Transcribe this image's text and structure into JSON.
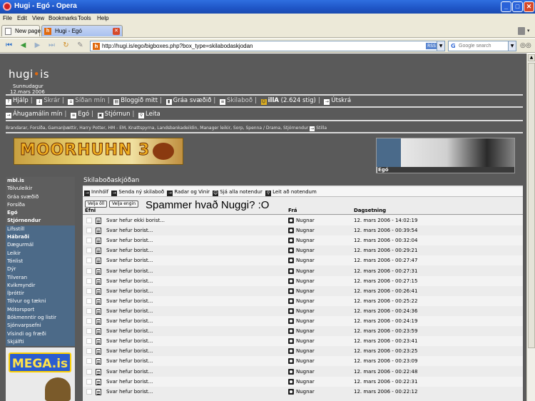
{
  "window": {
    "title": "Hugi - Egó - Opera"
  },
  "menu": [
    "File",
    "Edit",
    "View",
    "Bookmarks",
    "Tools",
    "Help"
  ],
  "tabs": [
    {
      "label": "New page"
    },
    {
      "label": "Hugi - Egó"
    }
  ],
  "address": {
    "url": "http://hugi.is/ego/bigboxes.php?box_type=skilabodaskjodan",
    "rss": "RSS"
  },
  "search": {
    "placeholder": "Google search"
  },
  "site": {
    "logo_text": "hugi",
    "logo_suffix": "is",
    "day": "Sunnudagur",
    "date": "12.mars 2006"
  },
  "topnav": {
    "row1": [
      {
        "label": "Hjálp"
      },
      {
        "label": "Skrár"
      },
      {
        "label": "Síðan mín"
      },
      {
        "label": "Bloggið mitt"
      },
      {
        "label": "Gráa svæðið"
      },
      {
        "label": "Skilaboð"
      },
      {
        "label": "illA",
        "extra": "(2.624 stig)"
      },
      {
        "label": "Útskrá"
      }
    ],
    "row2": [
      {
        "label": "Áhugamálin mín"
      },
      {
        "label": "Egó"
      },
      {
        "label": "Stjórnun"
      },
      {
        "label": "Leita"
      }
    ],
    "row3": "Brandarar, Forsíða, Gamanþættir, Harry Potter, HM - EM, Knattspyrna, Landsbankadeildin, Manager leikir, Sorp, Spenna / Drama, Stjórnendur",
    "row3_link": "Stilla"
  },
  "banners": {
    "moorhuhn": "MOORHUHN 3",
    "ego_label": "Egó",
    "mega": "MEGA.is"
  },
  "sidebar": {
    "top": [
      {
        "label": "mbl.is",
        "bold": true
      },
      {
        "label": "Tölvuleikir",
        "bold": false
      },
      {
        "label": "Gráa svæðið",
        "bold": false
      },
      {
        "label": "Forsíða",
        "bold": false
      },
      {
        "label": "Egó",
        "bold": true
      },
      {
        "label": "Stjórnendur",
        "bold": true
      }
    ],
    "bottom": [
      {
        "label": "Lífsstíll",
        "bold": false
      },
      {
        "label": "Hábraði",
        "bold": true
      },
      {
        "label": "Dægurmál",
        "bold": false
      },
      {
        "label": "Leikir",
        "bold": false
      },
      {
        "label": "Tónlist",
        "bold": false
      },
      {
        "label": "Dýr",
        "bold": false
      },
      {
        "label": "Tilveran",
        "bold": false
      },
      {
        "label": "Kvikmyndir",
        "bold": false
      },
      {
        "label": "Íþróttir",
        "bold": false
      },
      {
        "label": "Tölvur og tækni",
        "bold": false
      },
      {
        "label": "Mótorsport",
        "bold": false
      },
      {
        "label": "Bókmenntir og listir",
        "bold": false
      },
      {
        "label": "Sjónvarpsefni",
        "bold": false
      },
      {
        "label": "Vísindi og fræði",
        "bold": false
      },
      {
        "label": "Skjálfti",
        "bold": false
      }
    ]
  },
  "content": {
    "title": "Skilaboðaskjóðan",
    "actions": [
      "Innhólf",
      "Senda ný skilaboð",
      "Radar og Vinir",
      "Sjá alla notendur",
      "Leit að notendum"
    ],
    "select_all": "Velja öll",
    "select_none": "Velja engin",
    "heading": "Spammer hvað Nuggi? :O",
    "columns": {
      "subject": "Efni",
      "from": "Frá",
      "date": "Dagsetning"
    },
    "messages": [
      {
        "subject": "Svar hefur ekki borist...",
        "from": "Nugnar",
        "date": "12. mars 2006 - 14:02:19"
      },
      {
        "subject": "Svar hefur borist...",
        "from": "Nugnar",
        "date": "12. mars 2006 - 00:39:54"
      },
      {
        "subject": "Svar hefur borist...",
        "from": "Nugnar",
        "date": "12. mars 2006 - 00:32:04"
      },
      {
        "subject": "Svar hefur borist...",
        "from": "Nugnar",
        "date": "12. mars 2006 - 00:29:21"
      },
      {
        "subject": "Svar hefur borist...",
        "from": "Nugnar",
        "date": "12. mars 2006 - 00:27:47"
      },
      {
        "subject": "Svar hefur borist...",
        "from": "Nugnar",
        "date": "12. mars 2006 - 00:27:31"
      },
      {
        "subject": "Svar hefur borist...",
        "from": "Nugnar",
        "date": "12. mars 2006 - 00:27:15"
      },
      {
        "subject": "Svar hefur borist...",
        "from": "Nugnar",
        "date": "12. mars 2006 - 00:26:41"
      },
      {
        "subject": "Svar hefur borist...",
        "from": "Nugnar",
        "date": "12. mars 2006 - 00:25:22"
      },
      {
        "subject": "Svar hefur borist...",
        "from": "Nugnar",
        "date": "12. mars 2006 - 00:24:36"
      },
      {
        "subject": "Svar hefur borist...",
        "from": "Nugnar",
        "date": "12. mars 2006 - 00:24:19"
      },
      {
        "subject": "Svar hefur borist...",
        "from": "Nugnar",
        "date": "12. mars 2006 - 00:23:59"
      },
      {
        "subject": "Svar hefur borist...",
        "from": "Nugnar",
        "date": "12. mars 2006 - 00:23:41"
      },
      {
        "subject": "Svar hefur borist...",
        "from": "Nugnar",
        "date": "12. mars 2006 - 00:23:25"
      },
      {
        "subject": "Svar hefur borist...",
        "from": "Nugnar",
        "date": "12. mars 2006 - 00:23:09"
      },
      {
        "subject": "Svar hefur borist...",
        "from": "Nugnar",
        "date": "12. mars 2006 - 00:22:48"
      },
      {
        "subject": "Svar hefur borist...",
        "from": "Nugnar",
        "date": "12. mars 2006 - 00:22:31"
      },
      {
        "subject": "Svar hefur borist...",
        "from": "Nugnar",
        "date": "12. mars 2006 - 00:22:12"
      }
    ]
  }
}
